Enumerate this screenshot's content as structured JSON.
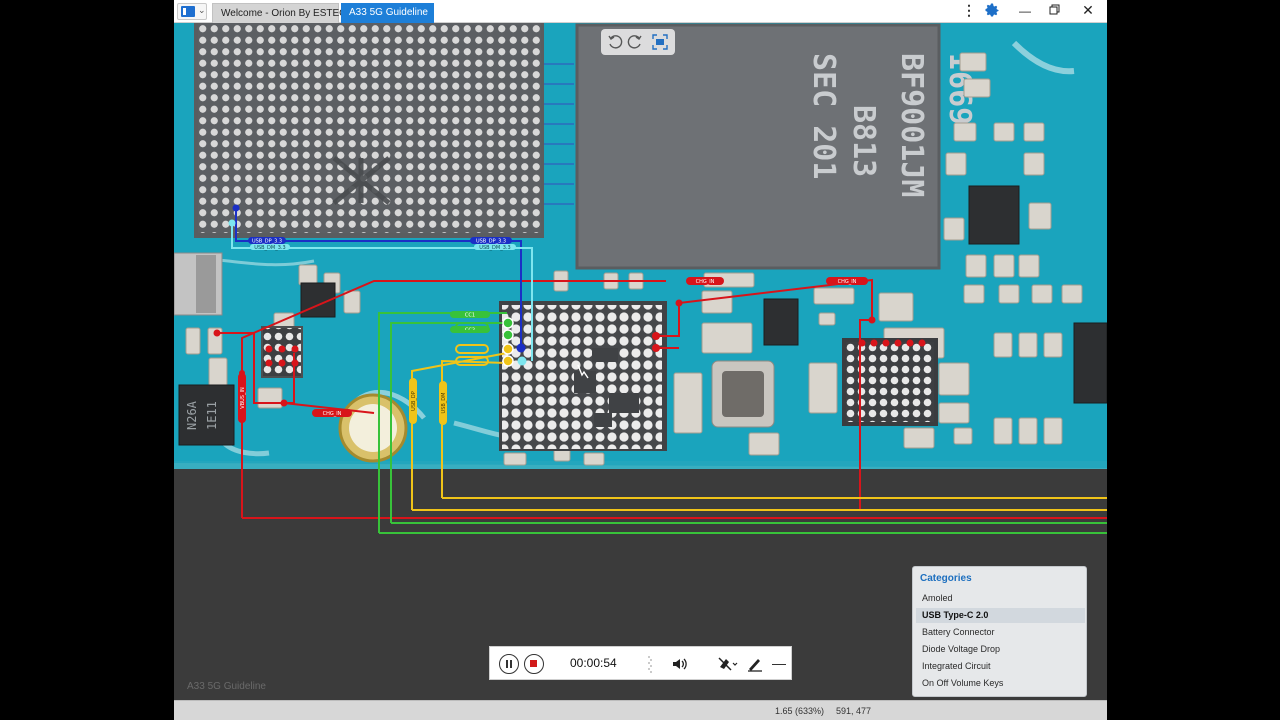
{
  "titlebar": {
    "tabs": [
      {
        "label": "Welcome - Orion By ESTECH"
      },
      {
        "label": "A33 5G Guideline"
      }
    ]
  },
  "board": {
    "chip_text": [
      "SEC 201",
      "B813",
      "BF9001JM",
      "I669"
    ],
    "component_text": [
      "N26A",
      "1E11"
    ],
    "net_labels": [
      "USB_DP_3.3",
      "USB_DM_3.3",
      "USB_DP_3.3",
      "USB_DM_3.3",
      "CHG_IN",
      "CHG_IN",
      "CHG_IN",
      "CC1",
      "CC2",
      "USB_DP",
      "USB_DM",
      "VBUS_IN"
    ]
  },
  "watermark": "A33 5G Guideline",
  "categories": {
    "title": "Categories",
    "items": [
      {
        "label": "Amoled",
        "active": false
      },
      {
        "label": "USB Type-C 2.0",
        "active": true
      },
      {
        "label": "Battery Connector",
        "active": false
      },
      {
        "label": "Diode Voltage Drop",
        "active": false
      },
      {
        "label": "Integrated Circuit",
        "active": false
      },
      {
        "label": "On Off Volume Keys",
        "active": false
      }
    ]
  },
  "recorder": {
    "time": "00:00:54"
  },
  "status": {
    "zoom": "1.65 (633%)",
    "coords": "591, 477"
  },
  "colors": {
    "accent": "#1d7fd8",
    "pcb": "#1aa6bf",
    "trace_red": "#d8141a",
    "trace_green": "#38c23a",
    "trace_yellow": "#f0c419",
    "trace_blue": "#1b2fc6",
    "trace_cyan": "#7ee6ef"
  }
}
